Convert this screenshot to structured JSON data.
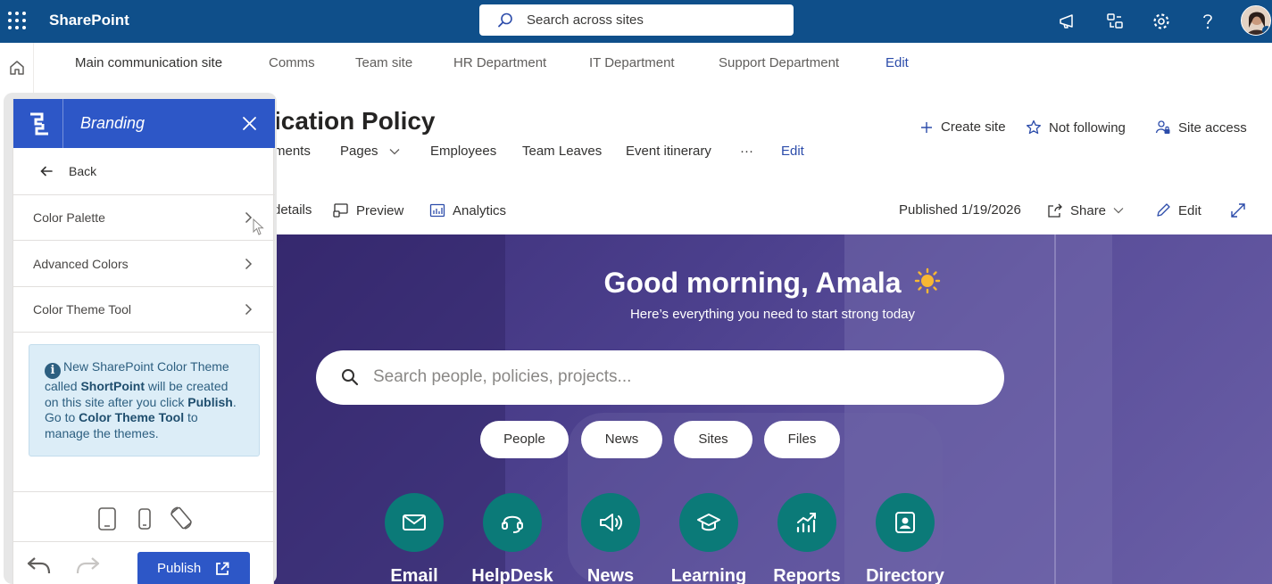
{
  "suitebar": {
    "app_name": "SharePoint",
    "search_placeholder": "Search across sites",
    "icons": [
      "waffle-icon",
      "megaphone-icon",
      "share-icon",
      "gear-icon",
      "help-icon"
    ]
  },
  "hubnav": {
    "items": [
      "Main communication site",
      "Comms",
      "Team site",
      "HR Department",
      "IT Department",
      "Support Department"
    ],
    "edit_label": "Edit"
  },
  "site": {
    "title_visible": "ication Policy",
    "actions": {
      "create_site": "Create site",
      "not_following": "Not following",
      "site_access": "Site access"
    },
    "topnav": {
      "items": [
        "ments",
        "Pages",
        "Employees",
        "Team Leaves",
        "Event itinerary"
      ],
      "more": "···",
      "edit_label": "Edit"
    }
  },
  "commandbar": {
    "details": "details",
    "preview": "Preview",
    "analytics": "Analytics",
    "published": "Published 1/19/2026",
    "share": "Share",
    "edit": "Edit"
  },
  "hero": {
    "greeting": "Good morning, Amala",
    "greeting_emoji": "☀️",
    "subtitle": "Here’s everything you need to start strong today",
    "search_placeholder": "Search people, policies, projects...",
    "chips": [
      "People",
      "News",
      "Sites",
      "Files"
    ],
    "tiles": [
      {
        "label": "Email",
        "icon": "mail-icon"
      },
      {
        "label": "HelpDesk",
        "icon": "headset-icon"
      },
      {
        "label": "News",
        "icon": "megaphone-icon"
      },
      {
        "label": "Learning",
        "icon": "graduation-cap-icon"
      },
      {
        "label": "Reports",
        "icon": "chart-icon"
      },
      {
        "label": "Directory",
        "icon": "contact-card-icon"
      }
    ],
    "tile_color": "#0b7a78"
  },
  "panel": {
    "title": "Branding",
    "back_label": "Back",
    "menu": [
      "Color Palette",
      "Advanced Colors",
      "Color Theme Tool"
    ],
    "info": {
      "t1": "New SharePoint Color Theme called ",
      "b1": "ShortPoint",
      "t2": " will be created on this site after you click ",
      "b2": "Publish",
      "t3": ". Go to ",
      "b3": "Color Theme Tool",
      "t4": " to manage the themes."
    },
    "publish_label": "Publish",
    "accent": "#2d57c7"
  }
}
